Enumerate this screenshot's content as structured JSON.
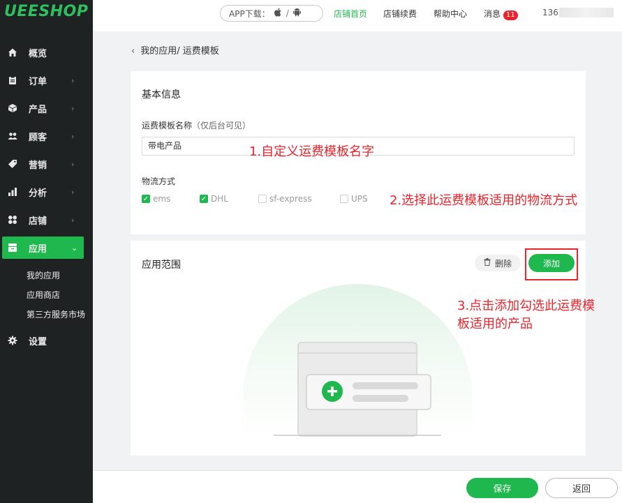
{
  "brand": {
    "logo": "UEESHOP"
  },
  "sidebar": {
    "items": [
      {
        "label": "概览",
        "icon": "home-icon",
        "has_chevron": false
      },
      {
        "label": "订单",
        "icon": "clipboard-icon",
        "has_chevron": true
      },
      {
        "label": "产品",
        "icon": "box-icon",
        "has_chevron": true
      },
      {
        "label": "顾客",
        "icon": "users-icon",
        "has_chevron": true
      },
      {
        "label": "营销",
        "icon": "tag-icon",
        "has_chevron": true
      },
      {
        "label": "分析",
        "icon": "bar-chart-icon",
        "has_chevron": true
      },
      {
        "label": "店铺",
        "icon": "grid-icon",
        "has_chevron": true
      },
      {
        "label": "应用",
        "icon": "apps-icon",
        "has_chevron": true,
        "active": true
      },
      {
        "label": "设置",
        "icon": "gear-icon",
        "has_chevron": false
      }
    ],
    "sub_items": [
      "我的应用",
      "应用商店",
      "第三方服务市场"
    ]
  },
  "topbar": {
    "app_download": "APP下载：",
    "links": [
      "店铺首页",
      "店铺续费",
      "帮助中心",
      "消息"
    ],
    "messages_badge": "11",
    "user_prefix": "136"
  },
  "breadcrumb": {
    "text": "我的应用/ 运费模板"
  },
  "basic_info": {
    "title": "基本信息",
    "name_label": "运费模板名称",
    "name_hint": "（仅后台可见）",
    "name_value": "带电产品",
    "logistics_label": "物流方式",
    "logistics_options": [
      {
        "label": "ems",
        "checked": true
      },
      {
        "label": "DHL",
        "checked": true
      },
      {
        "label": "sf-express",
        "checked": false
      },
      {
        "label": "UPS",
        "checked": false
      }
    ]
  },
  "scope": {
    "title": "应用范围",
    "delete_label": "删除",
    "add_label": "添加"
  },
  "annotations": {
    "step1": "1.自定义运费模板名字",
    "step2": "2.选择此运费模板适用的物流方式",
    "step3_line1": "3.点击添加勾选此运费模",
    "step3_line2": "板适用的产品"
  },
  "footer": {
    "save_label": "保存",
    "back_label": "返回"
  },
  "colors": {
    "accent": "#1fb84e",
    "annotation": "#e8232b",
    "sidebar_bg": "#1f2223"
  }
}
